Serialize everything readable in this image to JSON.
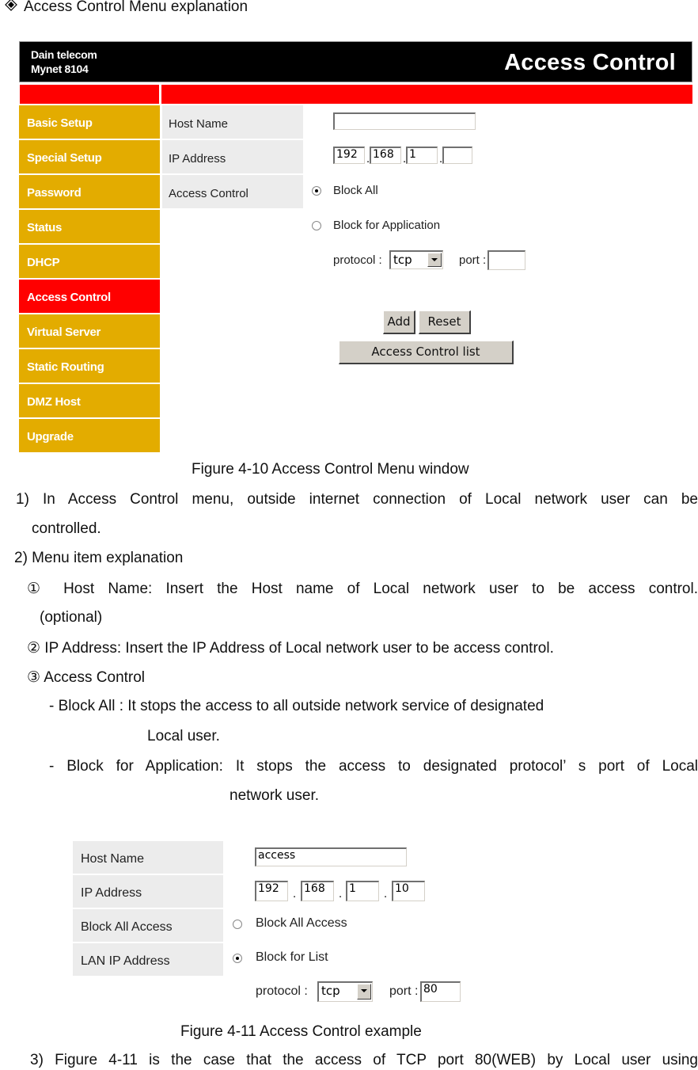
{
  "section_heading": {
    "icon": "diamond-bullet-icon",
    "text": "Access Control Menu explanation"
  },
  "figure1": {
    "header": {
      "brand_line1": "Dain telecom",
      "brand_line2": "Mynet 8104",
      "title": "Access Control"
    },
    "menu": [
      {
        "label": "Basic  Setup",
        "active": false
      },
      {
        "label": "Special Setup",
        "active": false
      },
      {
        "label": "Password",
        "active": false
      },
      {
        "label": "Status",
        "active": false
      },
      {
        "label": "DHCP",
        "active": false
      },
      {
        "label": "Access Control",
        "active": true
      },
      {
        "label": "Virtual Server",
        "active": false
      },
      {
        "label": "Static Routing",
        "active": false
      },
      {
        "label": "DMZ Host",
        "active": false
      },
      {
        "label": "Upgrade",
        "active": false
      }
    ],
    "field_labels": [
      "Host Name",
      "IP Address",
      "Access Control"
    ],
    "host_name_value": "",
    "ip": [
      "192",
      "168",
      "1",
      ""
    ],
    "radio_block_all": {
      "label": "Block All",
      "checked": true
    },
    "radio_block_app": {
      "label": "Block for Application",
      "checked": false
    },
    "protocol_label": "protocol :",
    "protocol_value": "tcp",
    "port_label": "port :",
    "port_value": "",
    "add_button": "Add",
    "reset_button": "Reset",
    "list_button": "Access Control list",
    "caption": "Figure 4-10 Access Control Menu window"
  },
  "body": {
    "p1_line1": "1) In Access Control menu, outside internet connection of Local network user can be",
    "p1_line2": "controlled.",
    "p2": "2) Menu item explanation",
    "item1_line1": "① Host Name: Insert the Host name of Local network user to be access control.",
    "item1_line2": "(optional)",
    "item2": "② IP Address: Insert the IP Address of Local network user to be access control.",
    "item3": "③ Access Control",
    "block_all_line1": "- Block All : It stops the access to all outside network service of designated",
    "block_all_line2": "Local user.",
    "block_app_line1": "- Block for Application: It stops the access to designated protocol’ s port of Local",
    "block_app_line2": "network user."
  },
  "figure2": {
    "field_labels": [
      "Host Name",
      "IP Address",
      "Block All Access",
      "LAN IP Address"
    ],
    "host_name_value": "access",
    "ip": [
      "192",
      "168",
      "1",
      "10"
    ],
    "radio_block_all": {
      "label": "Block All Access",
      "checked": false
    },
    "radio_block_list": {
      "label": "Block for List",
      "checked": true
    },
    "protocol_label": "protocol :",
    "protocol_value": "tcp",
    "port_label": "port :",
    "port_value": "80",
    "caption": "Figure 4-11 Access Control example"
  },
  "body2": {
    "p3_line1": "3) Figure 4-11 is the case that the access of TCP port 80(WEB) by Local user using"
  },
  "colors": {
    "menu_bg": "#e3ac00",
    "menu_active": "#ff0000",
    "header_bg": "#000000",
    "label_bg": "#ececec"
  }
}
